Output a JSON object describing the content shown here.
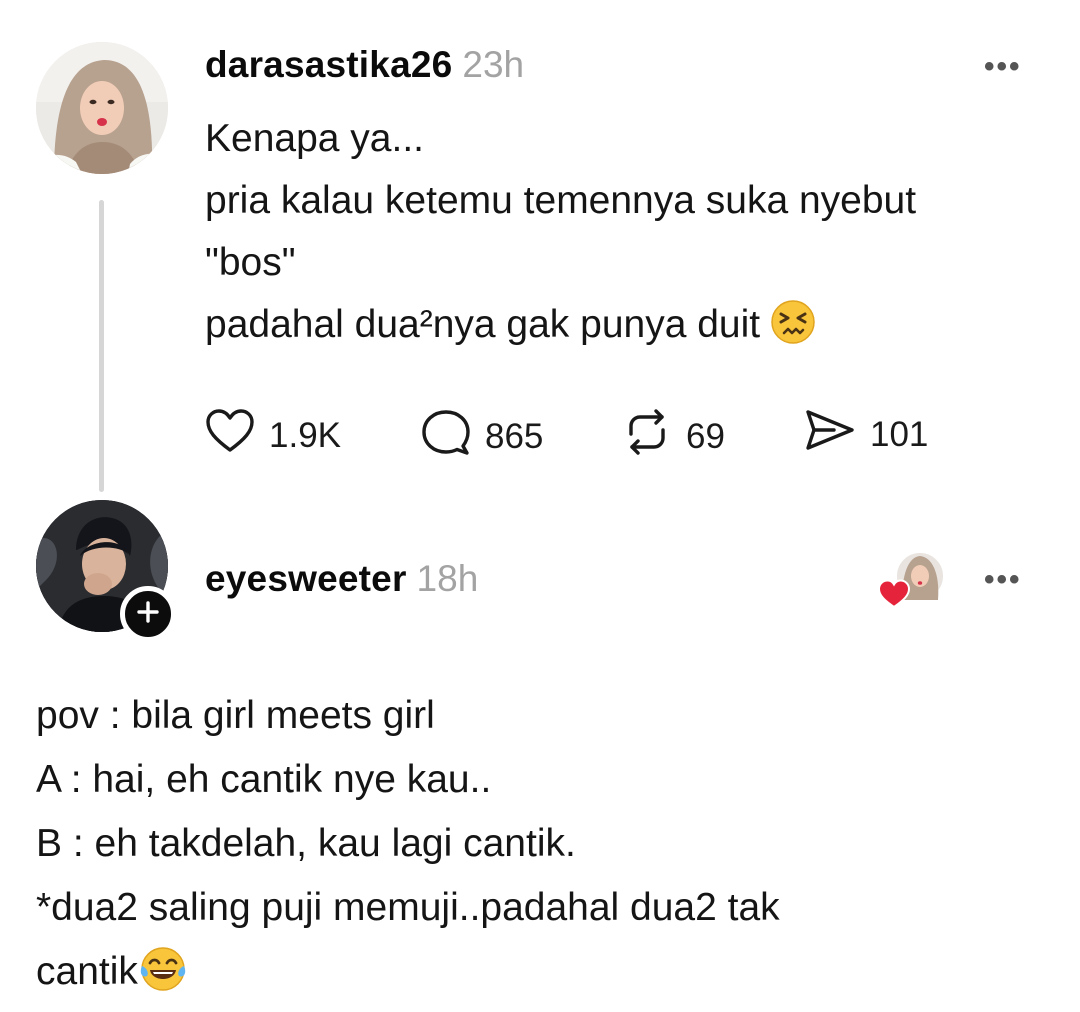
{
  "post1": {
    "username": "darasastika26",
    "time": "23h",
    "lines": [
      "Kenapa ya...",
      "pria kalau ketemu temennya suka nyebut",
      "\"bos\"",
      "padahal dua²nya gak punya duit"
    ],
    "emoji": "confounded-face-emoji",
    "actions": {
      "likes": "1.9K",
      "replies": "865",
      "reposts": "69",
      "shares": "101"
    }
  },
  "post2": {
    "username": "eyesweeter",
    "time": "18h",
    "lines": [
      "pov : bila girl meets girl",
      "A : hai, eh cantik nye kau..",
      "B : eh takdelah, kau lagi cantik.",
      "*dua2 saling puji memuji..padahal dua2 tak",
      "cantik"
    ],
    "emoji": "tears-of-joy-emoji"
  },
  "icons": {
    "more": "more-options-icon",
    "like": "heart-icon",
    "reply": "comment-bubble-icon",
    "repost": "repost-icon",
    "share": "send-icon",
    "follow": "plus-icon",
    "liked_by": "liked-by-author-heart-icon"
  },
  "colors": {
    "text": "#111111",
    "time": "#a3a3a3",
    "thread_line": "#d6d6d6",
    "liked_heart": "#e5243b"
  }
}
